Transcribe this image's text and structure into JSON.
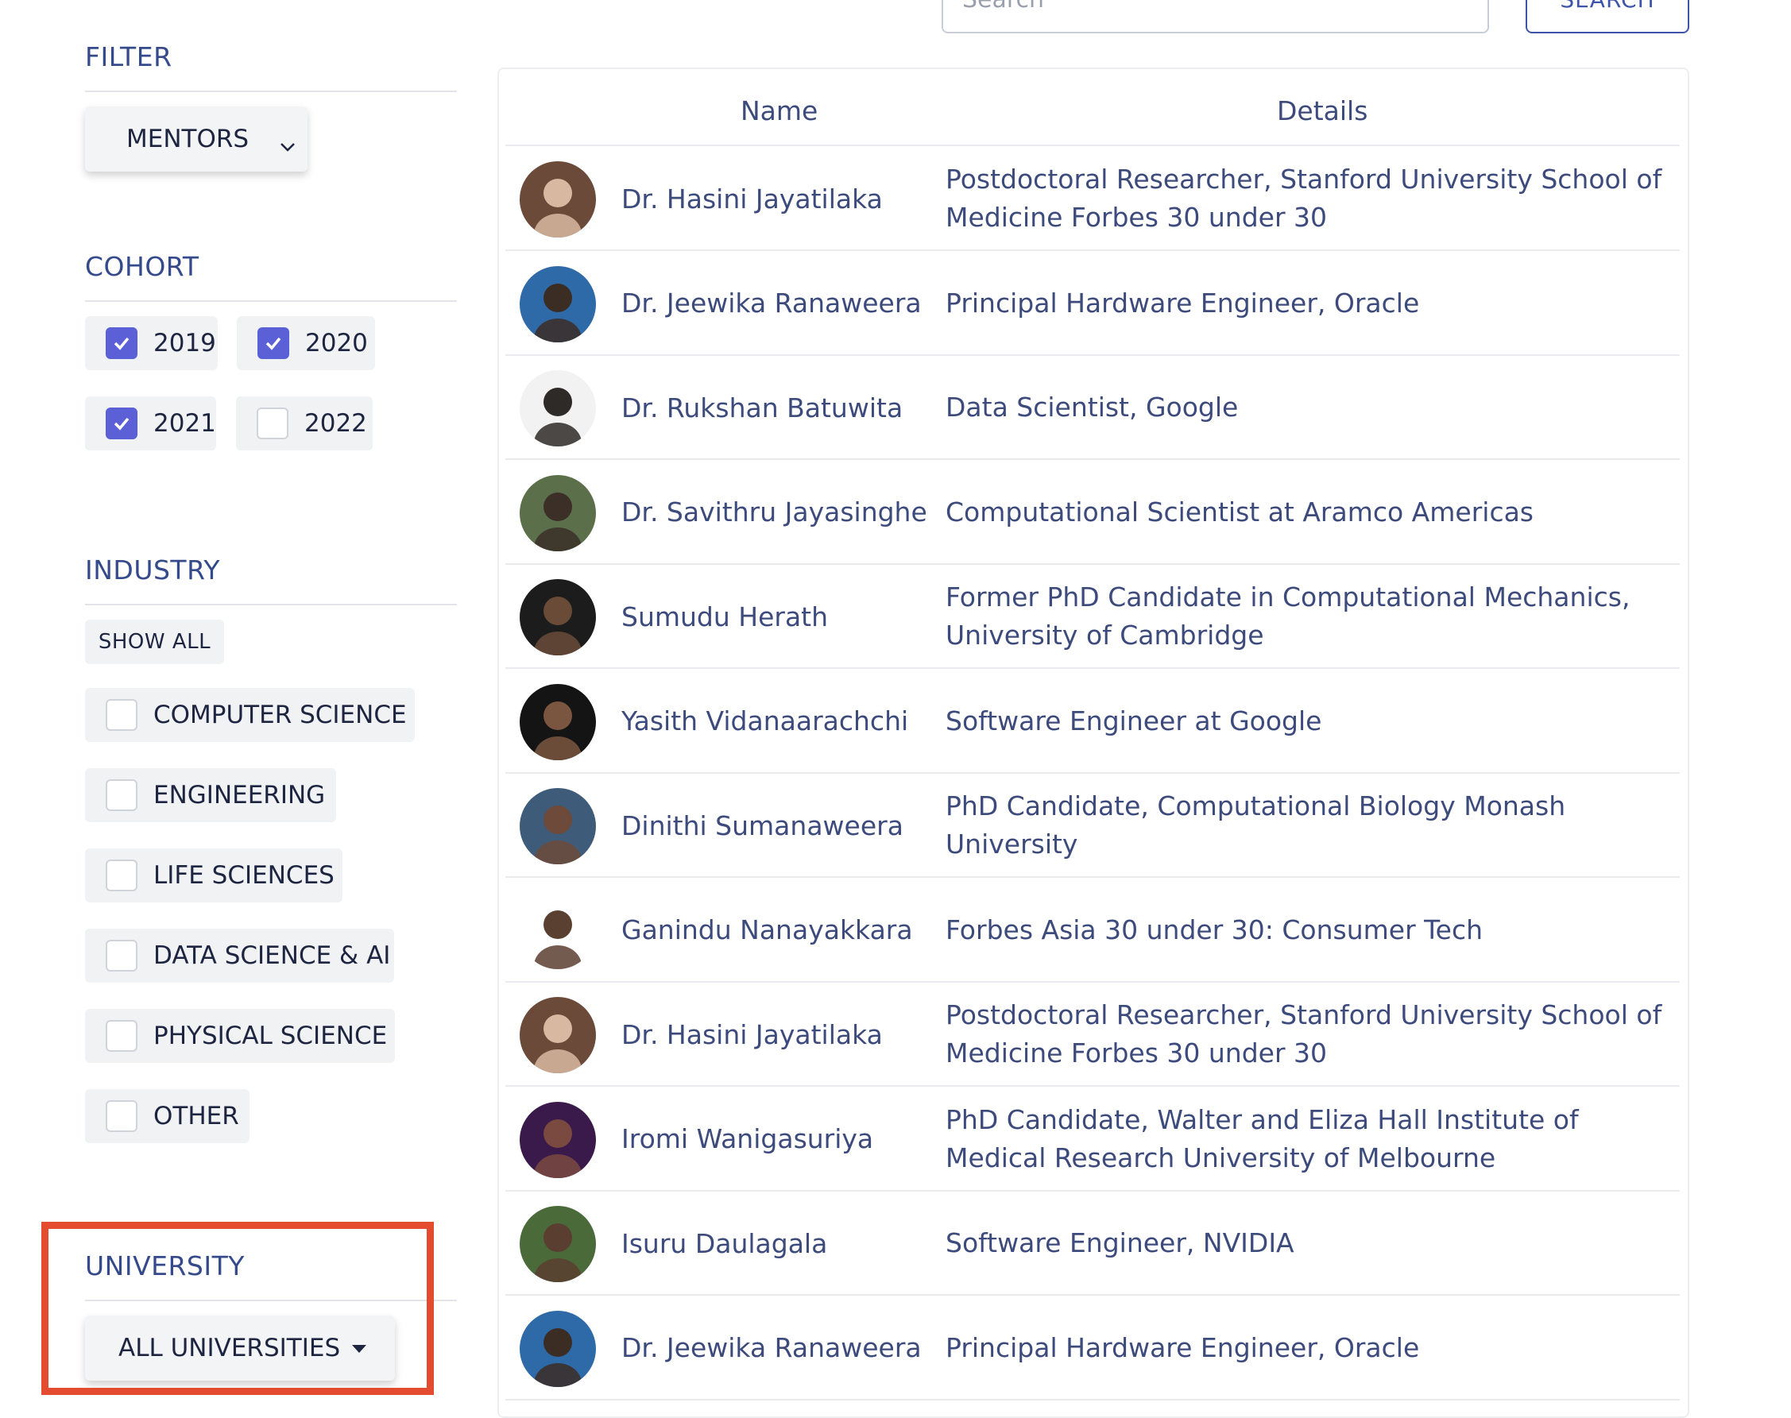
{
  "search": {
    "placeholder": "Search",
    "button_label": "SEARCH"
  },
  "filter": {
    "title": "FILTER",
    "type_dropdown": {
      "selected": "MENTORS"
    }
  },
  "cohort": {
    "title": "COHORT",
    "options": [
      {
        "label": "2019",
        "checked": true
      },
      {
        "label": "2020",
        "checked": true
      },
      {
        "label": "2021",
        "checked": true
      },
      {
        "label": "2022",
        "checked": false
      }
    ]
  },
  "industry": {
    "title": "INDUSTRY",
    "show_all_label": "SHOW ALL",
    "options": [
      {
        "label": "COMPUTER SCIENCE",
        "checked": false
      },
      {
        "label": "ENGINEERING",
        "checked": false
      },
      {
        "label": "LIFE SCIENCES",
        "checked": false
      },
      {
        "label": "DATA SCIENCE & AI",
        "checked": false
      },
      {
        "label": "PHYSICAL SCIENCE",
        "checked": false
      },
      {
        "label": "OTHER",
        "checked": false
      }
    ]
  },
  "university": {
    "title": "UNIVERSITY",
    "dropdown": {
      "selected": "ALL UNIVERSITIES"
    }
  },
  "table": {
    "headers": {
      "name": "Name",
      "details": "Details"
    },
    "rows": [
      {
        "name": "Dr. Hasini Jayatilaka",
        "details": "Postdoctoral Researcher, Stanford University School of Medicine Forbes 30 under 30"
      },
      {
        "name": "Dr. Jeewika Ranaweera",
        "details": "Principal Hardware Engineer, Oracle"
      },
      {
        "name": "Dr. Rukshan Batuwita",
        "details": "Data Scientist, Google"
      },
      {
        "name": "Dr. Savithru Jayasinghe",
        "details": "Computational Scientist at Aramco Americas"
      },
      {
        "name": "Sumudu Herath",
        "details": "Former PhD Candidate in Computational Mechanics, University of Cambridge"
      },
      {
        "name": "Yasith Vidanaarachchi",
        "details": "Software Engineer at Google"
      },
      {
        "name": "Dinithi Sumanaweera",
        "details": "PhD Candidate, Computational Biology Monash University"
      },
      {
        "name": "Ganindu Nanayakkara",
        "details": "Forbes Asia 30 under 30: Consumer Tech"
      },
      {
        "name": "Dr. Hasini Jayatilaka",
        "details": "Postdoctoral Researcher, Stanford University School of Medicine Forbes 30 under 30"
      },
      {
        "name": "Iromi Wanigasuriya",
        "details": "PhD Candidate, Walter and Eliza Hall Institute of Medical Research University of Melbourne"
      },
      {
        "name": "Isuru Daulagala",
        "details": "Software Engineer, NVIDIA"
      },
      {
        "name": "Dr. Jeewika Ranaweera",
        "details": "Principal Hardware Engineer, Oracle"
      }
    ]
  },
  "colors": {
    "accent": "#5b60d6",
    "highlight_box": "#e34c2f",
    "text": "#3c4a7c"
  }
}
